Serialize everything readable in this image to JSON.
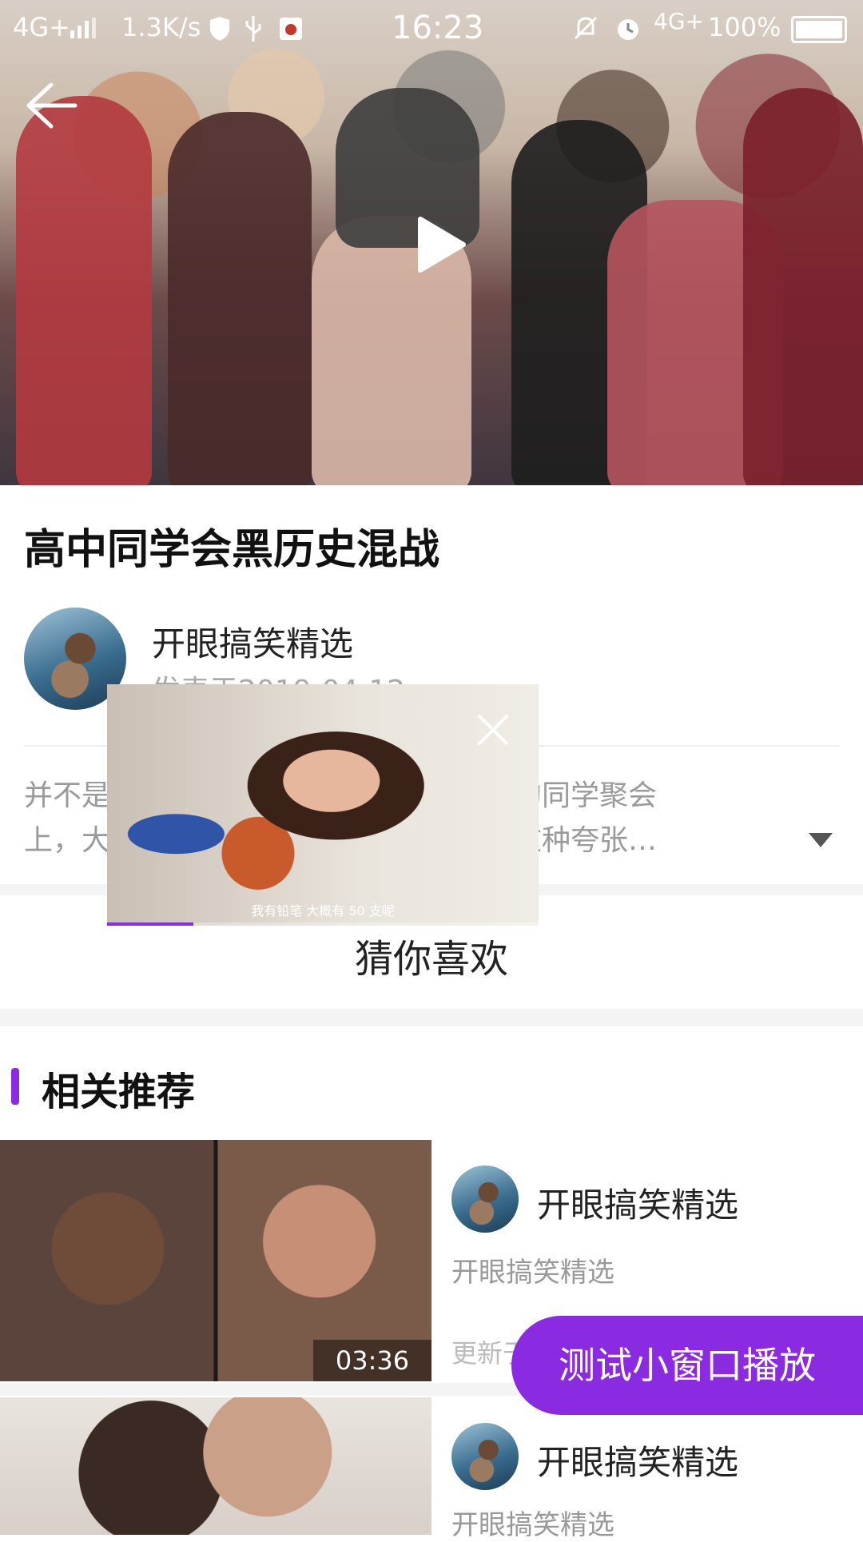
{
  "status_bar": {
    "network": "4G+",
    "speed": "1.3K/s",
    "time": "16:23",
    "network_right": "4G+",
    "battery": "100%"
  },
  "video": {
    "title": "高中同学会黑历史混战"
  },
  "author": {
    "name": "开眼搞笑精选",
    "date": "发表于2019-04-12"
  },
  "description": {
    "line1": "并不是所有人都会选择去参加一群奇葩的同学聚会",
    "line2": "上，大家都回到了最尴尬的时候。不过这种夸张…"
  },
  "guess_title": "猜你喜欢",
  "section": {
    "title": "相关推荐"
  },
  "recommendations": [
    {
      "author": "开眼搞笑精选",
      "subtitle": "开眼搞笑精选",
      "date": "更新于2019-04-12",
      "duration": "03:36"
    },
    {
      "author": "开眼搞笑精选",
      "subtitle": "开眼搞笑精选"
    }
  ],
  "mini_player": {
    "subtitle": "我有铅笔 大概有 50 支呢",
    "progress": 0.2
  },
  "fab": {
    "label": "测试小窗口播放"
  },
  "colors": {
    "accent": "#8a2be2"
  },
  "icons": [
    "back-arrow-icon",
    "play-icon",
    "close-icon",
    "expand-arrow-icon"
  ]
}
